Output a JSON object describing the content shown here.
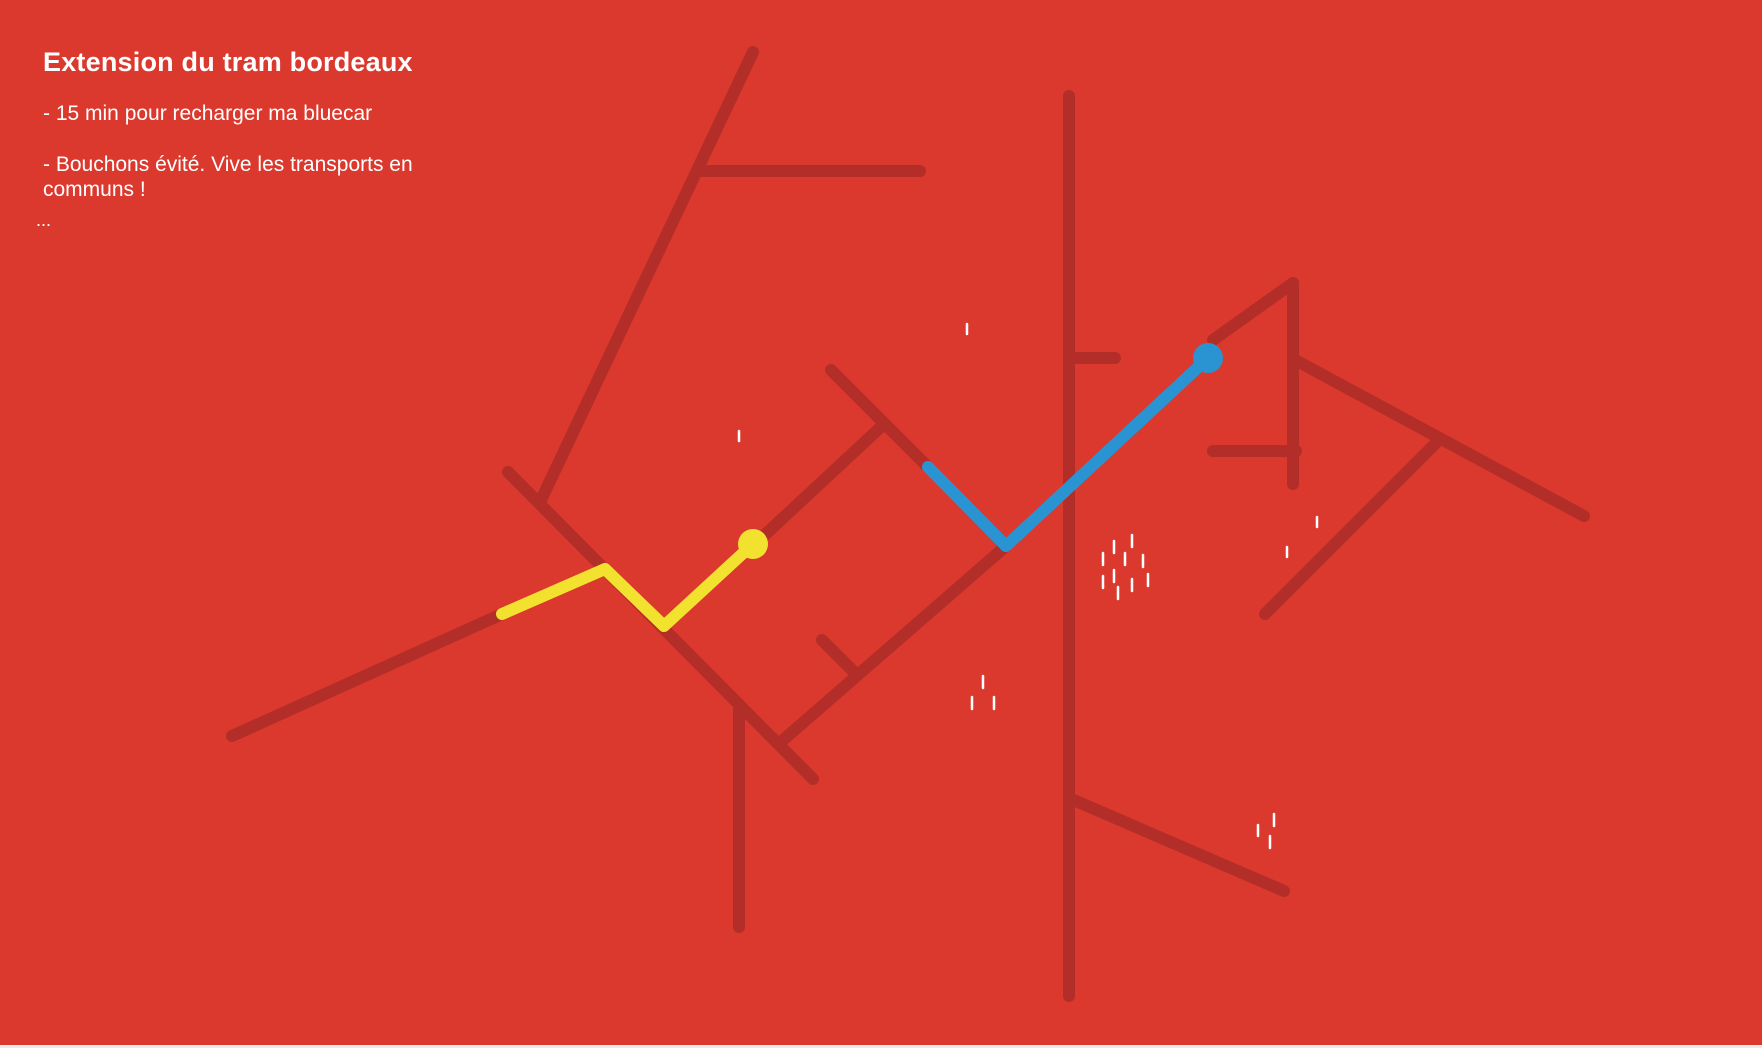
{
  "title": "Extension du tram bordeaux",
  "notes": [
    "- 15 min pour recharger ma bluecar",
    "- Bouchons évité. Vive les transports en communs !"
  ],
  "ellipsis": "...",
  "colors": {
    "background": "#db382e",
    "road": "#b32e28",
    "tram_yellow": "#f2e22f",
    "tram_blue": "#2a94d3",
    "marker": "#ffffff"
  }
}
